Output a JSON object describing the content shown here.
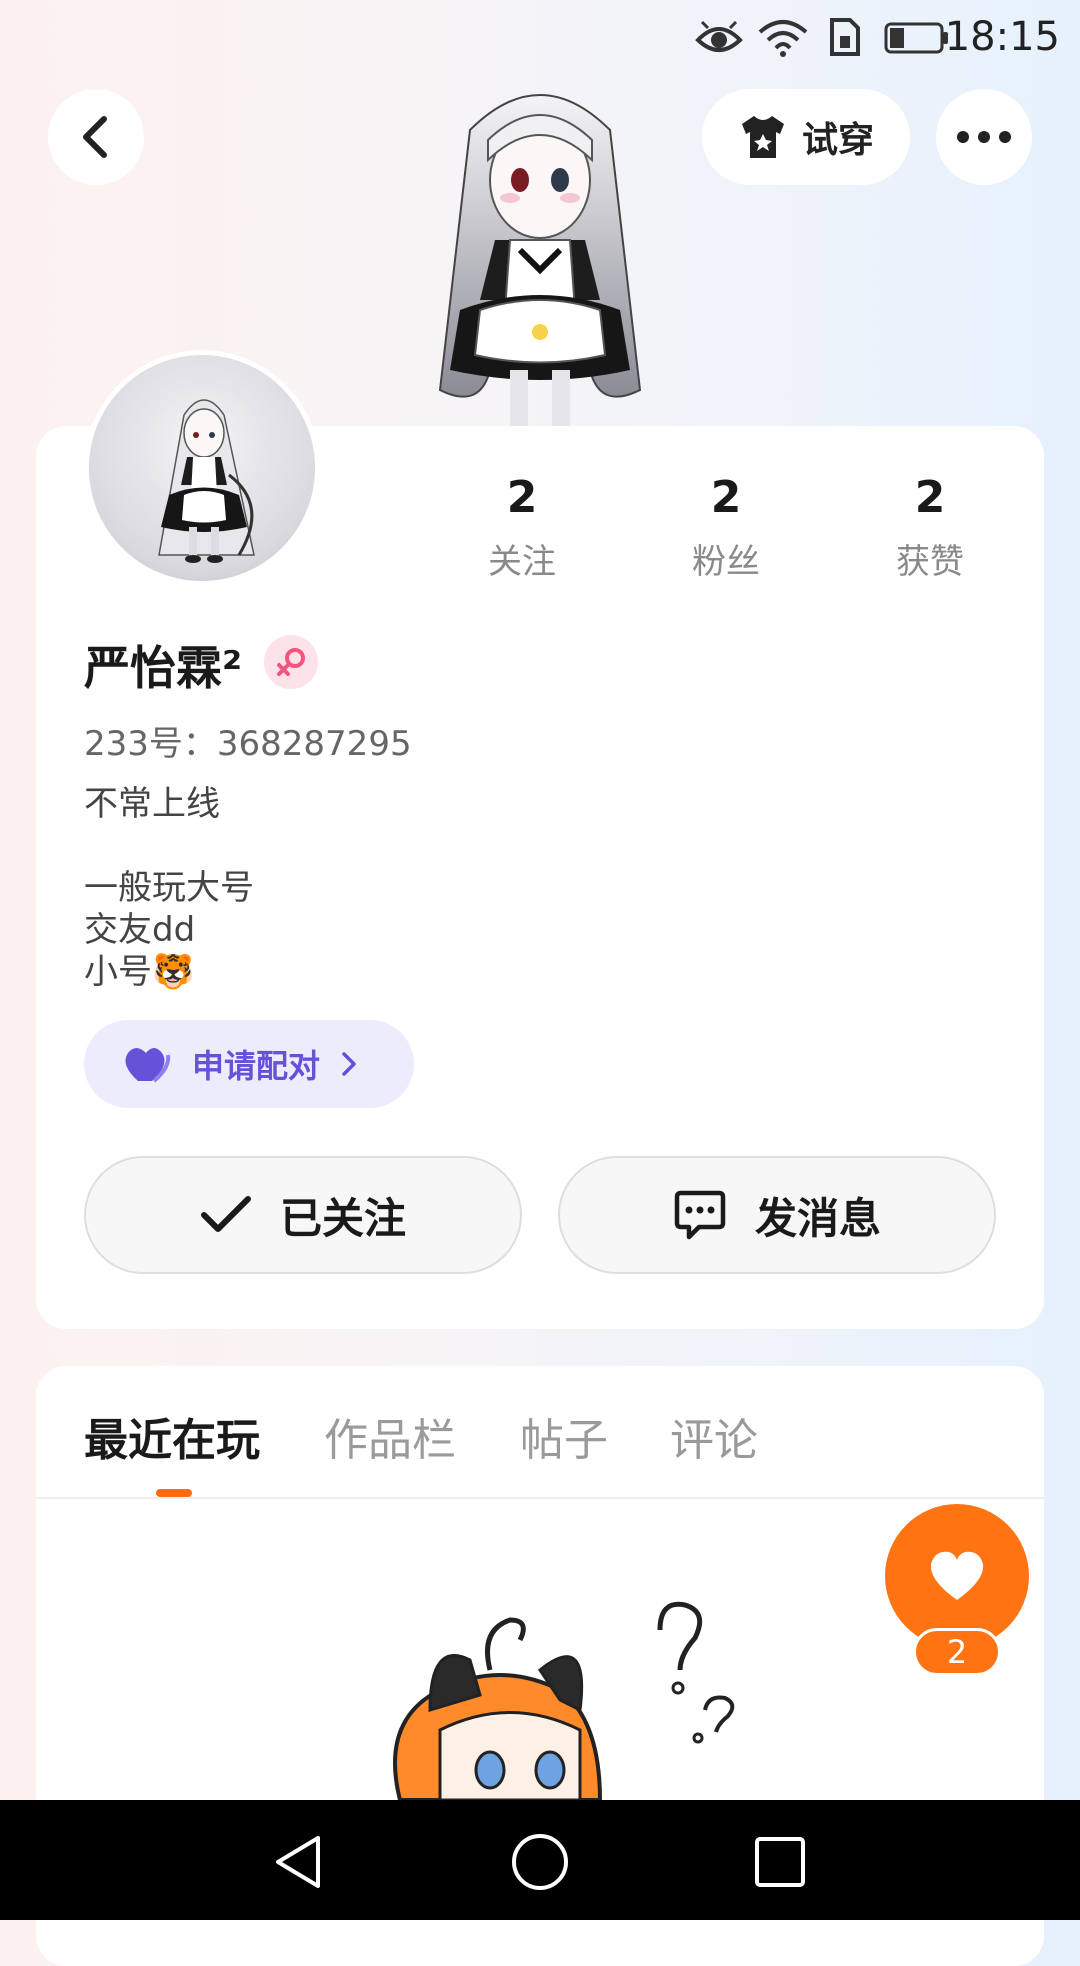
{
  "status_bar": {
    "time": "18:15",
    "icons": [
      "eye-icon",
      "wifi-icon",
      "sim-icon",
      "battery-icon"
    ]
  },
  "header": {
    "back_icon": "chevron-left-icon",
    "try_on_label": "试穿",
    "more_icon": "more-dots-icon"
  },
  "profile": {
    "name": "严怡霖²",
    "gender": "female",
    "uid_text": "233号：368287295",
    "bio": "不常上线\n\n一般玩大号\n交友dd\n小号🐯",
    "stats": [
      {
        "value": "2",
        "label": "关注"
      },
      {
        "value": "2",
        "label": "粉丝"
      },
      {
        "value": "2",
        "label": "获赞"
      }
    ],
    "pair_label": "申请配对",
    "follow_label": "已关注",
    "message_label": "发消息"
  },
  "tabs": [
    {
      "label": "最近在玩",
      "active": true
    },
    {
      "label": "作品栏",
      "active": false
    },
    {
      "label": "帖子",
      "active": false
    },
    {
      "label": "评论",
      "active": false
    }
  ],
  "like_fab": {
    "count": "2"
  },
  "colors": {
    "accent": "#ff7412",
    "pair_bg": "#ececfd",
    "pair_text": "#6552d9",
    "female_badge": "#fde2ea"
  }
}
